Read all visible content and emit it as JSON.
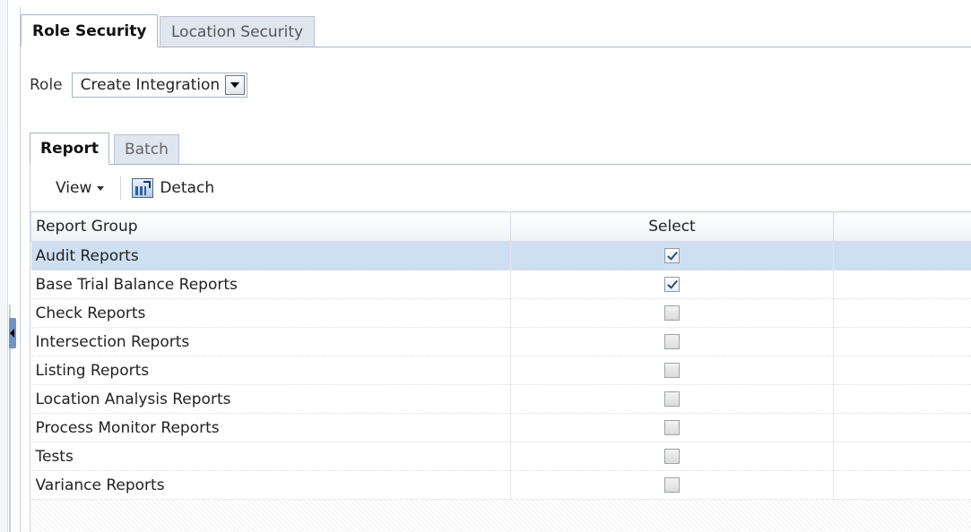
{
  "tabs": {
    "outer": [
      {
        "label": "Role Security",
        "active": true
      },
      {
        "label": "Location Security",
        "active": false
      }
    ],
    "inner": [
      {
        "label": "Report",
        "active": true
      },
      {
        "label": "Batch",
        "active": false
      }
    ]
  },
  "role": {
    "label": "Role",
    "selected_value": "Create Integration"
  },
  "toolbar": {
    "view_label": "View",
    "detach_label": "Detach"
  },
  "table": {
    "columns": [
      "Report Group",
      "Select",
      ""
    ],
    "rows": [
      {
        "group": "Audit Reports",
        "checked": true,
        "selected": true
      },
      {
        "group": "Base Trial Balance Reports",
        "checked": true,
        "selected": false
      },
      {
        "group": "Check Reports",
        "checked": false,
        "selected": false
      },
      {
        "group": "Intersection Reports",
        "checked": false,
        "selected": false
      },
      {
        "group": "Listing Reports",
        "checked": false,
        "selected": false
      },
      {
        "group": "Location Analysis Reports",
        "checked": false,
        "selected": false
      },
      {
        "group": "Process Monitor Reports",
        "checked": false,
        "selected": false
      },
      {
        "group": "Tests",
        "checked": false,
        "selected": false
      },
      {
        "group": "Variance Reports",
        "checked": false,
        "selected": false
      }
    ]
  },
  "colors": {
    "selected_row": "#cfdff2",
    "tab_inactive": "#dfe6ee",
    "border": "#a8b6c6"
  },
  "icons": {
    "detach": "detach-chart-icon",
    "view_caret": "caret-down-icon",
    "dropdown": "dropdown-arrow-icon",
    "collapse": "collapse-pane-icon"
  }
}
